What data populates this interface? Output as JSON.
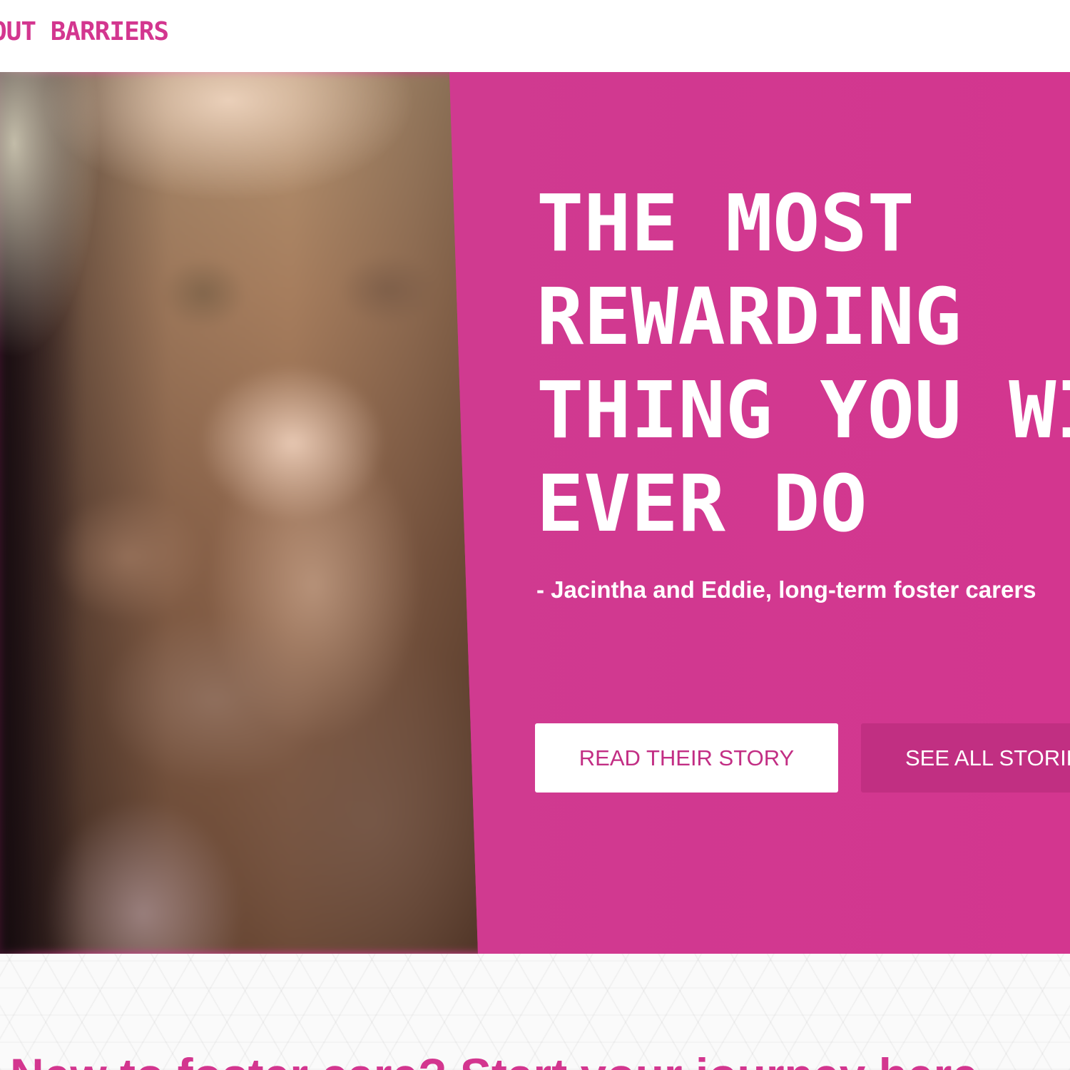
{
  "header": {
    "brand_text": "OUT BARRIERS"
  },
  "hero": {
    "headline": "THE MOST\nREWARDING\nTHING YOU WILL\nEVER DO",
    "quote": "- Jacintha and Eddie, long-term foster carers",
    "primary_button_label": "READ THEIR STORY",
    "secondary_button_label": "SEE ALL STORIES"
  },
  "intro": {
    "heading": "New to foster care? Start your journey here"
  },
  "colors": {
    "brand_pink": "#d3368f",
    "button_dark_pink": "#c12f82",
    "white": "#ffffff"
  }
}
